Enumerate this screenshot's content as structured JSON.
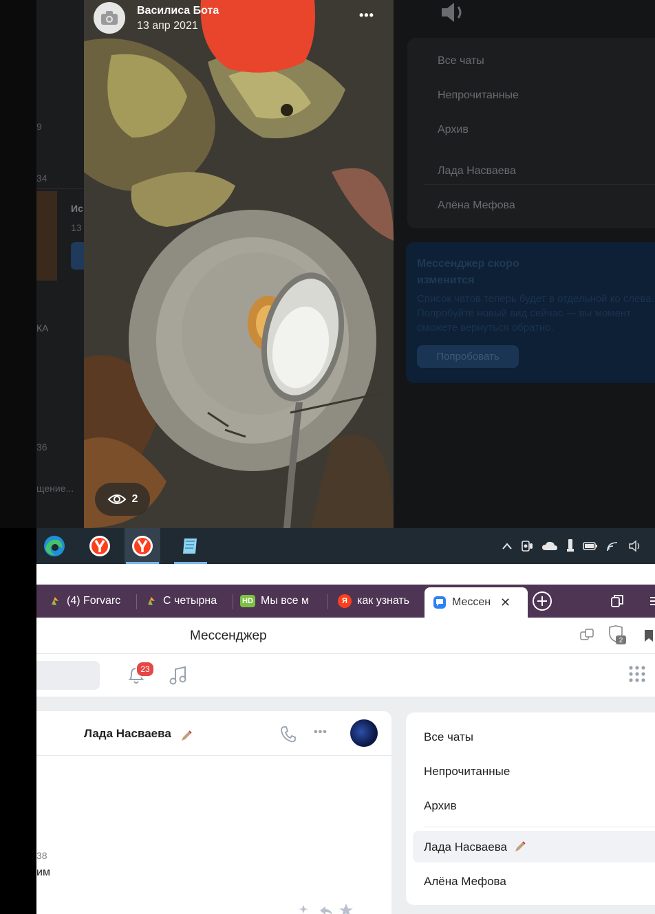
{
  "story": {
    "author": "Василиса Бота",
    "date": "13 апр 2021",
    "views": "2",
    "icons": [
      "camera-icon",
      "more-icon",
      "eye-icon"
    ]
  },
  "background_left": {
    "fragments": [
      "9",
      "34",
      "Ис",
      "13",
      "КА",
      "36",
      "щение..."
    ]
  },
  "background_right": {
    "items": [
      "Все чаты",
      "Непрочитанные",
      "Архив",
      "Лада Насваева",
      "Алёна Мефова"
    ],
    "promo": {
      "title": "Мессенджер скоро изменится",
      "text": "Список чатов теперь будет в отдельной ко слева. Попробуйте новый вид сейчас — вы момент сможете вернуться обратно.",
      "button": "Попробовать"
    }
  },
  "taskbar": {
    "apps": [
      "edge-icon",
      "yandex-browser-icon",
      "yandex-browser-icon",
      "notepad-icon"
    ],
    "tray": [
      "chevron-up-icon",
      "camera-mic-icon",
      "cloud-icon",
      "usb-icon",
      "battery-icon",
      "wifi-icon",
      "volume-icon"
    ]
  },
  "browser": {
    "tabs": [
      {
        "label": "(4) Forvarc",
        "icon": "pikabu-icon",
        "color": "#f5a623"
      },
      {
        "label": "С четырна",
        "icon": "pikabu-icon",
        "color": "#f5a623"
      },
      {
        "label": "Мы все м",
        "icon": "hd-icon",
        "color": "#7bc043",
        "badge": "HD"
      },
      {
        "label": "как узнать",
        "icon": "yandex-icon",
        "color": "#fc3f1d",
        "badge": "Я"
      },
      {
        "label": "Мессен",
        "icon": "messenger-icon",
        "color": "#2d81f7"
      }
    ],
    "page_title": "Мессенджер",
    "toolbar_icons": [
      "translate-icon",
      "protect-icon",
      "bookmark-icon"
    ],
    "protect_count": "2"
  },
  "vk": {
    "notifications_count": "23",
    "chat": {
      "name": "Лада Насваева",
      "time_fragment": "38",
      "text_fragment": "им"
    },
    "sidebar": {
      "items": [
        "Все чаты",
        "Непрочитанные",
        "Архив",
        "Лада Насваева",
        "Алёна Мефова"
      ]
    }
  },
  "colors": {
    "tabbar": "#4f3554",
    "taskbar": "#1f2a33",
    "badge": "#e64646"
  }
}
